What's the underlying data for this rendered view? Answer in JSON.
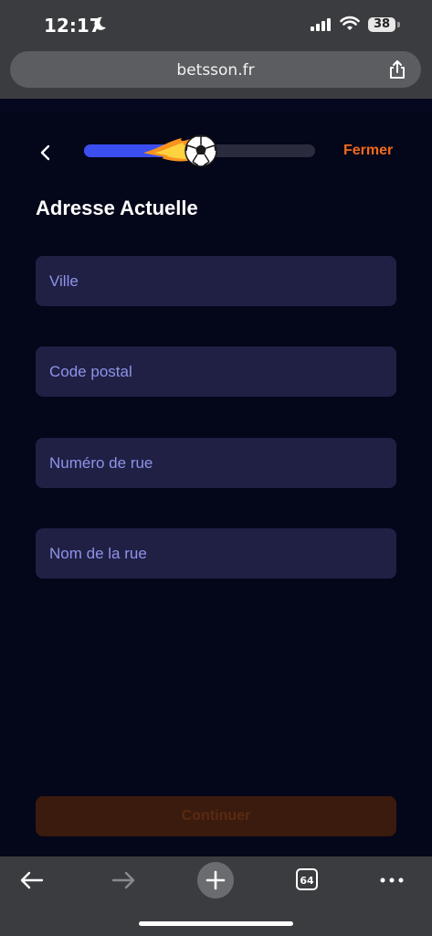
{
  "status_bar": {
    "time": "12:17",
    "battery": "38"
  },
  "browser": {
    "url": "betsson.fr",
    "tab_count": "64"
  },
  "header": {
    "close_label": "Fermer",
    "progress_fraction": 0.52
  },
  "form": {
    "title": "Adresse Actuelle",
    "fields": [
      {
        "placeholder": "Ville",
        "value": ""
      },
      {
        "placeholder": "Code postal",
        "value": ""
      },
      {
        "placeholder": "Numéro de rue",
        "value": ""
      },
      {
        "placeholder": "Nom de la rue",
        "value": ""
      }
    ],
    "continue_label": "Continuer"
  },
  "colors": {
    "accent_orange": "#f26a1b",
    "progress_blue": "#3b4ff0",
    "field_bg": "#202045",
    "placeholder": "#8e93e8",
    "page_bg": "#04061a"
  }
}
